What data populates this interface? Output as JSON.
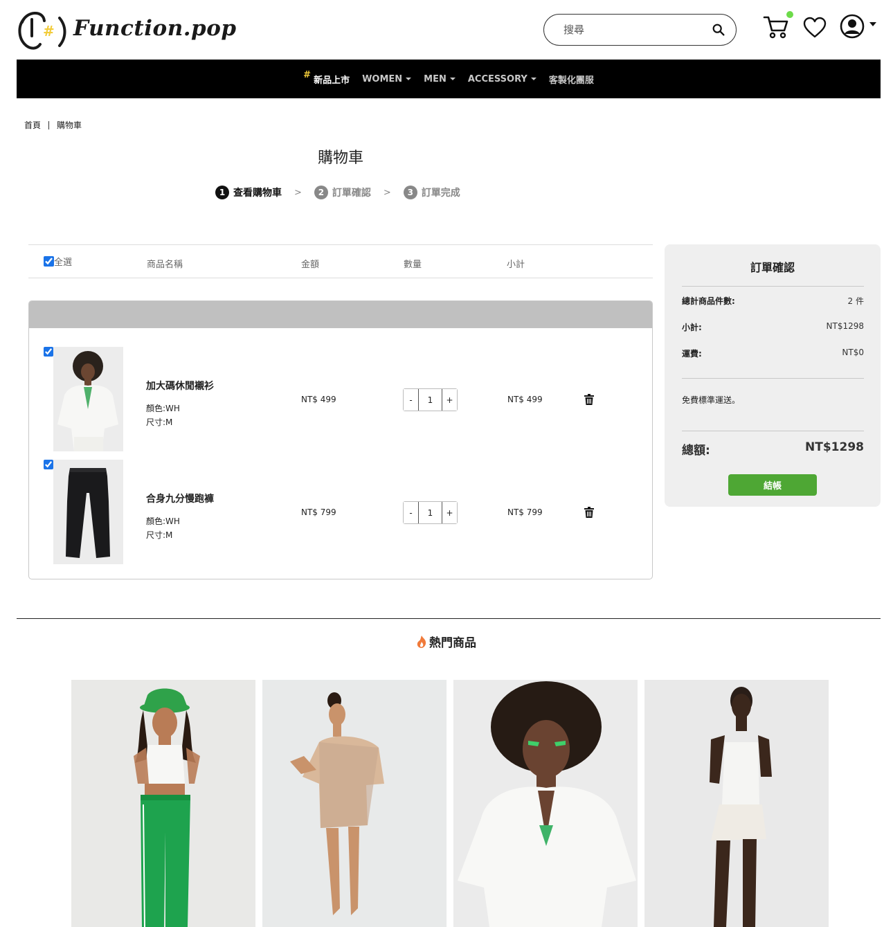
{
  "brand": {
    "name": "Function",
    "suffix": ".pop",
    "accent": "#f2cc3a"
  },
  "search": {
    "placeholder": "搜尋"
  },
  "nav": {
    "hash": "#",
    "items": [
      {
        "label": "新品上市"
      },
      {
        "label": "WOMEN"
      },
      {
        "label": "MEN"
      },
      {
        "label": "ACCESSORY"
      },
      {
        "label": "客製化團服"
      }
    ]
  },
  "breadcrumb": {
    "home": "首頁",
    "current": "購物車"
  },
  "page_title": "購物車",
  "steps": {
    "arrow": ">",
    "items": [
      {
        "num": "1",
        "label": "查看購物車"
      },
      {
        "num": "2",
        "label": "訂單確認"
      },
      {
        "num": "3",
        "label": "訂單完成"
      }
    ]
  },
  "table_header": {
    "select_all": "全選",
    "name": "商品名稱",
    "price": "金額",
    "qty": "數量",
    "subtotal": "小計"
  },
  "cart_items": [
    {
      "name": "加大碼休閒襯衫",
      "color": "顏色:WH",
      "size": "尺寸:M",
      "price": "NT$ 499",
      "qty": "1",
      "subtotal": "NT$ 499",
      "checked": true
    },
    {
      "name": "合身九分慢跑褲",
      "color": "顏色:WH",
      "size": "尺寸:M",
      "price": "NT$ 799",
      "qty": "1",
      "subtotal": "NT$ 799",
      "checked": true
    }
  ],
  "qty_controls": {
    "minus": "-",
    "plus": "+"
  },
  "summary": {
    "title": "訂單確認",
    "count_label": "總計商品件數:",
    "count_value": "2 件",
    "subtotal_label": "小計:",
    "subtotal_value": "NT$1298",
    "shipping_label": "運費:",
    "shipping_value": "NT$0",
    "note": "免費標準運送。",
    "total_label": "總額:",
    "total_value": "NT$1298",
    "checkout": "結帳",
    "checkout_color": "#4ea734"
  },
  "hot": {
    "title": "熱門商品",
    "icon": "fire-icon"
  },
  "colors": {
    "nav_bg": "#000000",
    "cart_dot": "#6ddb4a",
    "header_bar": "#c0c0c0",
    "summary_bg": "#efefef"
  }
}
